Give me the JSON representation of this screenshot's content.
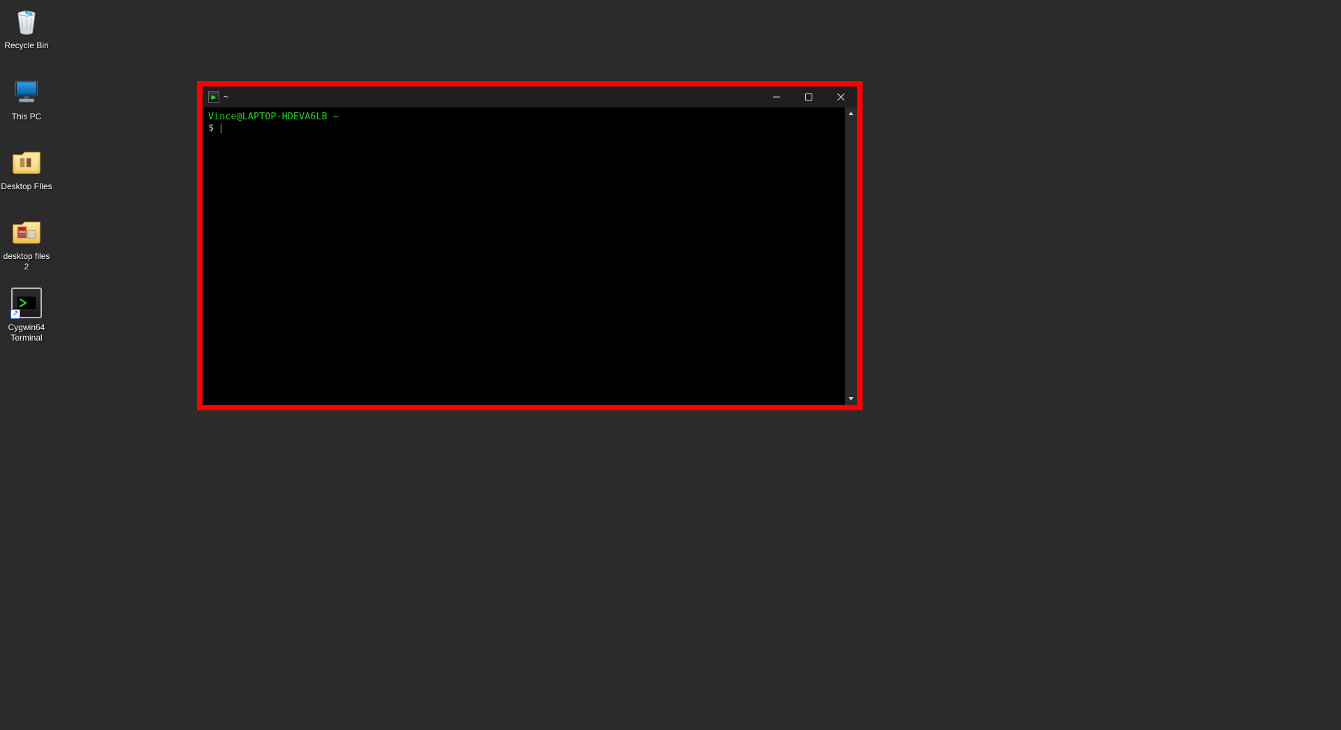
{
  "desktop": {
    "icons": [
      {
        "id": "recycle-bin",
        "label": "Recycle Bin"
      },
      {
        "id": "this-pc",
        "label": "This PC"
      },
      {
        "id": "desktop-files",
        "label": "Desktop FIles"
      },
      {
        "id": "desktop-files-2",
        "label": "desktop files 2"
      },
      {
        "id": "cygwin",
        "label": "Cygwin64 Terminal"
      }
    ]
  },
  "terminal": {
    "title": "~",
    "prompt_user_host": "Vince@LAPTOP-HDEVA6LB",
    "prompt_path": "~",
    "prompt_symbol": "$",
    "highlight_color": "#ff0000",
    "prompt_color": "#28d028"
  }
}
